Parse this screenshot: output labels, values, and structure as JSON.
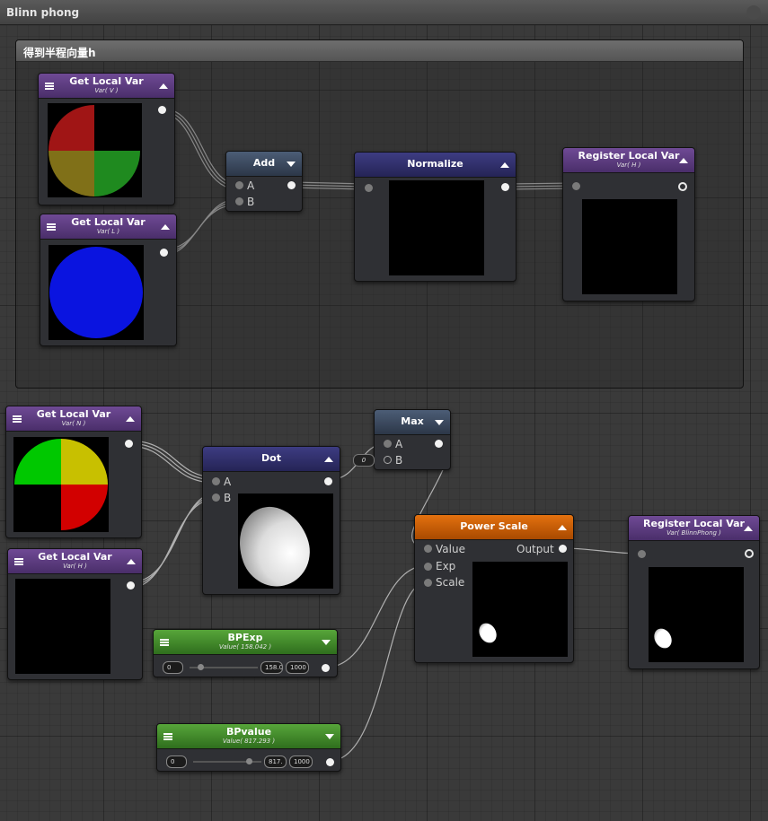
{
  "graph": {
    "title": "Blinn phong"
  },
  "group": {
    "title": "得到半程向量h"
  },
  "nodes": {
    "getV": {
      "title": "Get Local Var",
      "subtitle": "Var( V )"
    },
    "getL": {
      "title": "Get Local Var",
      "subtitle": "Var( L )"
    },
    "add": {
      "title": "Add",
      "port_a": "A",
      "port_b": "B"
    },
    "normalize": {
      "title": "Normalize"
    },
    "registerH": {
      "title": "Register Local Var",
      "subtitle": "Var( H )"
    },
    "getN": {
      "title": "Get Local Var",
      "subtitle": "Var( N )"
    },
    "getH": {
      "title": "Get Local Var",
      "subtitle": "Var( H )"
    },
    "dot": {
      "title": "Dot",
      "port_a": "A",
      "port_b": "B"
    },
    "max": {
      "title": "Max",
      "port_a": "A",
      "port_b": "B",
      "b_default": "0"
    },
    "powerScale": {
      "title": "Power Scale",
      "port_value": "Value",
      "port_exp": "Exp",
      "port_scale": "Scale",
      "port_output": "Output"
    },
    "registerBP": {
      "title": "Register Local Var",
      "subtitle": "Var( BlinnPhong )"
    },
    "bpexp": {
      "title": "BPExp",
      "subtitle": "Value( 158.042 )",
      "min": "0",
      "value": "158.0",
      "max": "1000",
      "fraction": 0.158
    },
    "bpvalue": {
      "title": "BPvalue",
      "subtitle": "Value( 817.293 )",
      "min": "0",
      "value": "817.",
      "max": "1000",
      "fraction": 0.817
    }
  },
  "colors": {
    "purple_header": "#5a3a80",
    "navy_header": "#2e2d68",
    "slate_header": "#3b4a5e",
    "orange_header": "#d4670a",
    "green_header": "#43882a"
  }
}
